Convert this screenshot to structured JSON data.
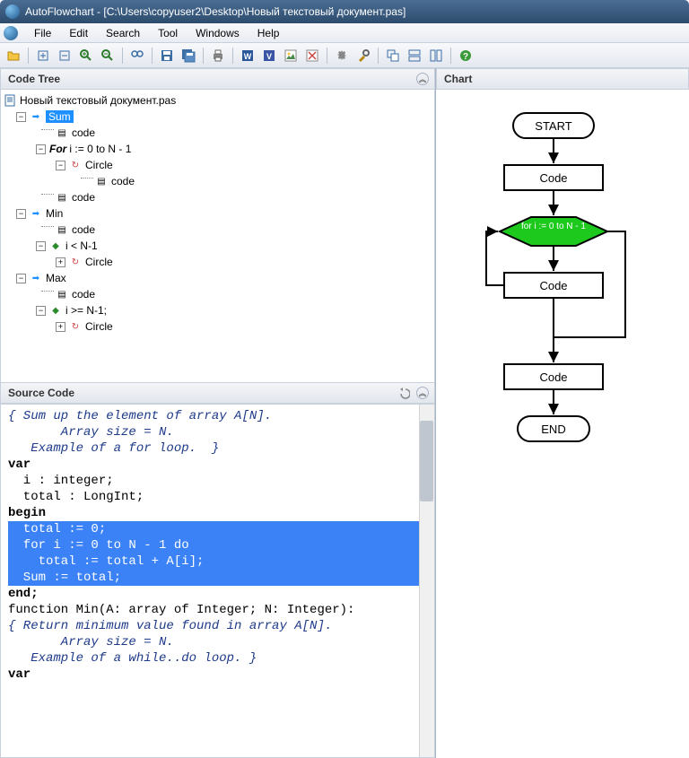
{
  "title": "AutoFlowchart - [C:\\Users\\copyuser2\\Desktop\\Новый текстовый документ.pas]",
  "menu": {
    "file": "File",
    "edit": "Edit",
    "search": "Search",
    "tool": "Tool",
    "windows": "Windows",
    "help": "Help"
  },
  "panels": {
    "codeTree": "Code Tree",
    "sourceCode": "Source Code",
    "chart": "Chart"
  },
  "tree": {
    "root": "Новый текстовый документ.pas",
    "sum": "Sum",
    "code": "code",
    "forLoop": "i := 0 to N - 1",
    "forKw": "For",
    "circle": "Circle",
    "min": "Min",
    "iLtN": "i < N-1",
    "max": "Max",
    "iGeN": "i >= N-1;"
  },
  "src": {
    "c1": "{ Sum up the element of array A[N].",
    "c2": "       Array size = N.",
    "c3": "   Example of a for loop.  }",
    "l4": "var",
    "l5": "  i : integer;",
    "l6": "  total : LongInt;",
    "l7": "begin",
    "s1": "  total := 0;",
    "s2": "  for i := 0 to N - 1 do",
    "s3": "    total := total + A[i];",
    "s4": "",
    "s5": "  Sum := total;",
    "l9": "end;",
    "l10": "",
    "l11": "function Min(A: array of Integer; N: Integer):",
    "c4": "{ Return minimum value found in array A[N].",
    "c5": "       Array size = N.",
    "c6": "   Example of a while..do loop. }",
    "l12": "var"
  },
  "chart": {
    "start": "START",
    "code1": "Code",
    "loop": "for i := 0 to N - 1",
    "code2": "Code",
    "code3": "Code",
    "end": "END"
  }
}
